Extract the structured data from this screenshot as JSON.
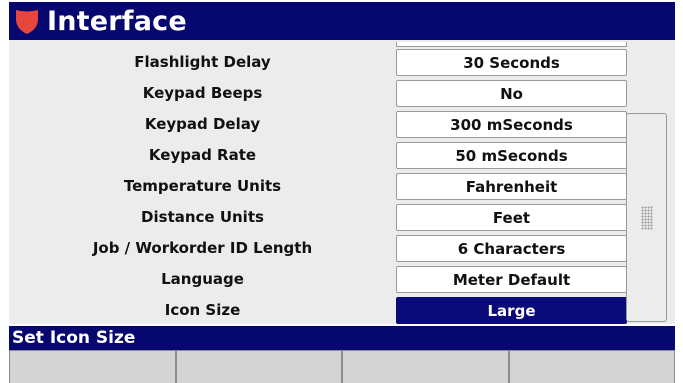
{
  "header": {
    "title": "Interface",
    "logo_icon": "shield-icon",
    "background_color": "#070770"
  },
  "settings": [
    {
      "label": "Flashlight Delay",
      "value": "30 Seconds",
      "selected": false
    },
    {
      "label": "Keypad Beeps",
      "value": "No",
      "selected": false
    },
    {
      "label": "Keypad Delay",
      "value": "300 mSeconds",
      "selected": false
    },
    {
      "label": "Keypad Rate",
      "value": "50 mSeconds",
      "selected": false
    },
    {
      "label": "Temperature Units",
      "value": "Fahrenheit",
      "selected": false
    },
    {
      "label": "Distance Units",
      "value": "Feet",
      "selected": false
    },
    {
      "label": "Job / Workorder ID Length",
      "value": "6 Characters",
      "selected": false
    },
    {
      "label": "Language",
      "value": "Meter Default",
      "selected": false
    },
    {
      "label": "Icon Size",
      "value": "Large",
      "selected": true
    }
  ],
  "status": {
    "text": "Set Icon Size"
  },
  "softkeys": [
    {
      "label": ""
    },
    {
      "label": ""
    },
    {
      "label": ""
    },
    {
      "label": ""
    }
  ],
  "colors": {
    "accent": "#070770",
    "selected": "#0a0a78",
    "logo": "#e8463c"
  }
}
